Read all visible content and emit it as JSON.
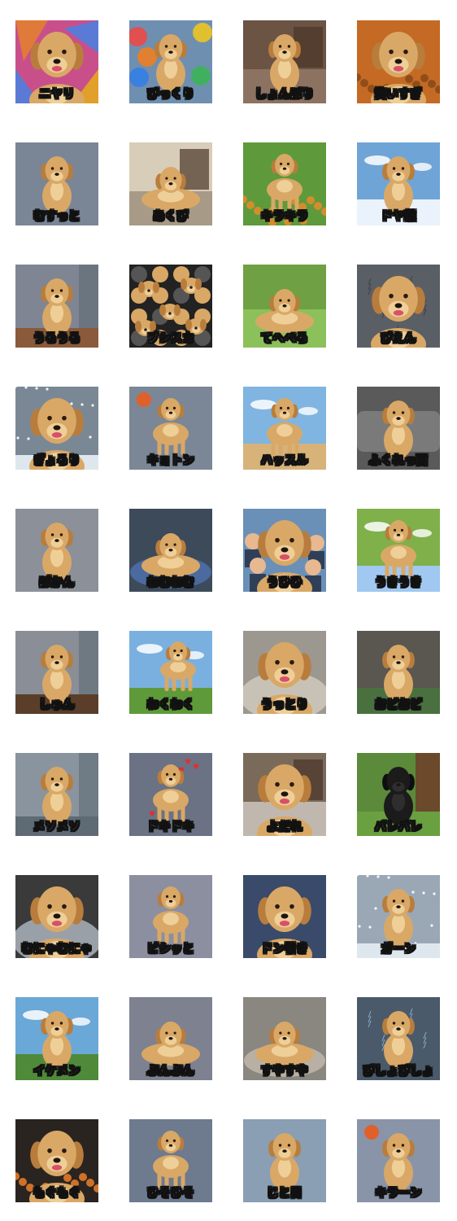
{
  "colors": {
    "page_bg": "#ffffff",
    "caption_text": "#ffffff",
    "caption_outline": "#111111",
    "dog_fur": "#d9a866",
    "dog_fur_light": "#efcf98",
    "dog_ear": "#b87d3c",
    "black_dog": "#1b1b1b"
  },
  "stickers": [
    {
      "caption": "ニヤリ",
      "bg": "#c94f8a",
      "bg2": "#5a7ad6",
      "scene": "abstract",
      "dog": "face"
    },
    {
      "caption": "びっくり",
      "bg": "#6f8fb0",
      "bg2": "#e05050",
      "scene": "balloons",
      "dog": "sitting"
    },
    {
      "caption": "しょんぼり",
      "bg": "#6b5444",
      "bg2": "#8c7260",
      "scene": "room",
      "dog": "sitting"
    },
    {
      "caption": "笑いすぎ",
      "bg": "#c46a24",
      "bg2": "#8a4a1a",
      "scene": "autumn",
      "dog": "face"
    },
    {
      "caption": "むすっと",
      "bg": "#7a8596",
      "bg2": "#6c7585",
      "scene": "plain",
      "dog": "sitting"
    },
    {
      "caption": "あくび",
      "bg": "#d8cdb8",
      "bg2": "#a79a86",
      "scene": "room-light",
      "dog": "lying"
    },
    {
      "caption": "キラキラ",
      "bg": "#5e9a3c",
      "bg2": "#e08c2a",
      "scene": "flowers",
      "dog": "standing"
    },
    {
      "caption": "ドヤ顔",
      "bg": "#6fa4d6",
      "bg2": "#eaf2fb",
      "scene": "sky",
      "dog": "sitting"
    },
    {
      "caption": "うるうる",
      "bg": "#7f8592",
      "bg2": "#8a5a3a",
      "scene": "floor",
      "dog": "sitting"
    },
    {
      "caption": "ブシスカ",
      "bg": "#222222",
      "bg2": "#d9a866",
      "scene": "pattern",
      "dog": "many"
    },
    {
      "caption": "てへぺろ",
      "bg": "#6fa043",
      "bg2": "#8bc05a",
      "scene": "grass",
      "dog": "lying"
    },
    {
      "caption": "ぴえん",
      "bg": "#5a5f66",
      "bg2": "#3c4046",
      "scene": "rain",
      "dog": "face"
    },
    {
      "caption": "ぎょろり",
      "bg": "#7a8896",
      "bg2": "#cfd8e0",
      "scene": "snow",
      "dog": "face"
    },
    {
      "caption": "キョトン",
      "bg": "#7b8796",
      "bg2": "#e0602a",
      "scene": "balloon",
      "dog": "standing"
    },
    {
      "caption": "ハッスル",
      "bg": "#7fb5e0",
      "bg2": "#d7b37a",
      "scene": "beach",
      "dog": "standing"
    },
    {
      "caption": "ふくれっ面",
      "bg": "#5a5a5a",
      "bg2": "#7a7a7a",
      "scene": "sofa",
      "dog": "sitting"
    },
    {
      "caption": "ぽかん",
      "bg": "#8c9098",
      "bg2": "#6a5040",
      "scene": "plain",
      "dog": "sitting"
    },
    {
      "caption": "ねむねむ",
      "bg": "#3c4a5a",
      "bg2": "#4a6aa0",
      "scene": "bed",
      "dog": "lying"
    },
    {
      "caption": "うひひ",
      "bg": "#6a90b8",
      "bg2": "#2f3f58",
      "scene": "kids",
      "dog": "face"
    },
    {
      "caption": "うきうき",
      "bg": "#7fb04a",
      "bg2": "#a0c8f0",
      "scene": "field",
      "dog": "standing"
    },
    {
      "caption": "しゅん",
      "bg": "#8a8e96",
      "bg2": "#5a3e2a",
      "scene": "door",
      "dog": "sitting"
    },
    {
      "caption": "わくわく",
      "bg": "#7ab0e0",
      "bg2": "#5f9a3a",
      "scene": "jump",
      "dog": "jumping"
    },
    {
      "caption": "うっとり",
      "bg": "#9c9890",
      "bg2": "#c8c2b6",
      "scene": "blanket",
      "dog": "face"
    },
    {
      "caption": "おどおど",
      "bg": "#5a5650",
      "bg2": "#4a7040",
      "scene": "dark",
      "dog": "sitting"
    },
    {
      "caption": "メソメソ",
      "bg": "#8a949e",
      "bg2": "#5e6a74",
      "scene": "door",
      "dog": "sitting"
    },
    {
      "caption": "ドキドキ",
      "bg": "#6a7284",
      "bg2": "#e03030",
      "scene": "hearts",
      "dog": "standing"
    },
    {
      "caption": "よだれ",
      "bg": "#7a6a5a",
      "bg2": "#c0b8ae",
      "scene": "kitchen",
      "dog": "face"
    },
    {
      "caption": "バレバレ",
      "bg": "#5a8a3a",
      "bg2": "#6a4a2a",
      "scene": "tree",
      "dog": "black"
    },
    {
      "caption": "むにゃむにゃ",
      "bg": "#3a3a3a",
      "bg2": "#9aa0a8",
      "scene": "blanket-dark",
      "dog": "face"
    },
    {
      "caption": "ピシッと",
      "bg": "#8c8fa0",
      "bg2": "#7c8090",
      "scene": "plain",
      "dog": "standing-tall"
    },
    {
      "caption": "ドン引き",
      "bg": "#3a4a6a",
      "bg2": "#2a3a5a",
      "scene": "plain-dark",
      "dog": "face"
    },
    {
      "caption": "ガーン",
      "bg": "#9aa8b6",
      "bg2": "#5a4a3a",
      "scene": "winter",
      "dog": "sitting"
    },
    {
      "caption": "イケメン",
      "bg": "#6aa8d8",
      "bg2": "#4f8a3a",
      "scene": "park",
      "dog": "sitting"
    },
    {
      "caption": "ぷんぷん",
      "bg": "#7e8290",
      "bg2": "#6e7280",
      "scene": "plain",
      "dog": "lying"
    },
    {
      "caption": "すやすや",
      "bg": "#8a8680",
      "bg2": "#b8b0a4",
      "scene": "bed-light",
      "dog": "lying"
    },
    {
      "caption": "びしょびしょ",
      "bg": "#4a5a6a",
      "bg2": "#8ab0d0",
      "scene": "splash",
      "dog": "sitting"
    },
    {
      "caption": "もぐもぐ",
      "bg": "#2a2420",
      "bg2": "#e07a2a",
      "scene": "fruit",
      "dog": "face"
    },
    {
      "caption": "ひそひそ",
      "bg": "#6e7a8e",
      "bg2": "#5e6a7e",
      "scene": "plain",
      "dog": "standing"
    },
    {
      "caption": "じと目",
      "bg": "#8a9eb4",
      "bg2": "#5a6a7e",
      "scene": "plain",
      "dog": "sitting"
    },
    {
      "caption": "キラーン",
      "bg": "#8a94a8",
      "bg2": "#e0602a",
      "scene": "ball",
      "dog": "sitting"
    }
  ]
}
